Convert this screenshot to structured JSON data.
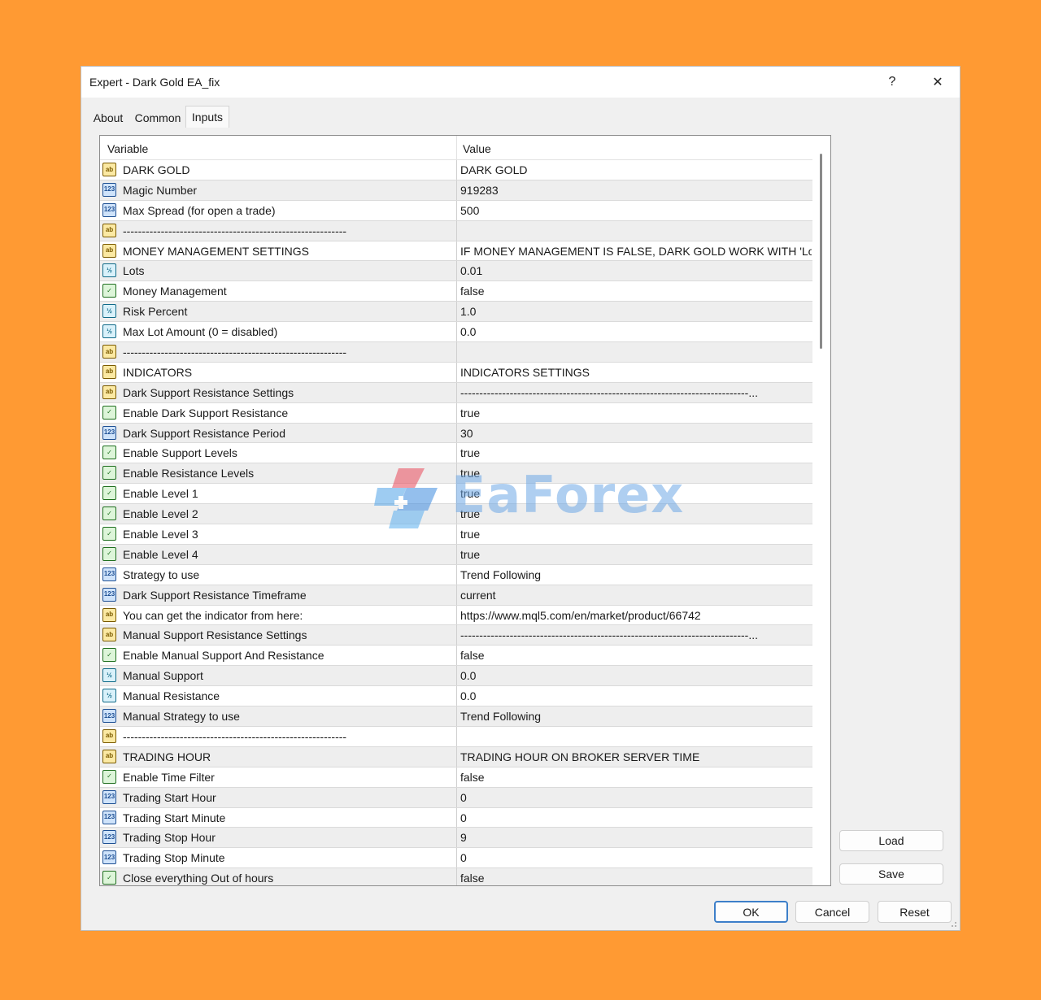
{
  "window": {
    "title": "Expert - Dark Gold EA_fix",
    "help_glyph": "?",
    "close_glyph": "✕"
  },
  "tabs": [
    {
      "label": "About"
    },
    {
      "label": "Common"
    },
    {
      "label": "Inputs"
    }
  ],
  "grid": {
    "headers": {
      "variable": "Variable",
      "value": "Value"
    },
    "rows": [
      {
        "type": "string",
        "variable": "DARK GOLD",
        "value": "DARK GOLD"
      },
      {
        "type": "int",
        "variable": "Magic Number",
        "value": "919283"
      },
      {
        "type": "int",
        "variable": "Max Spread (for open a trade)",
        "value": "500"
      },
      {
        "type": "string",
        "variable": "-----------------------------------------------------------",
        "value": ""
      },
      {
        "type": "string",
        "variable": "MONEY MANAGEMENT SETTINGS",
        "value": "IF MONEY MANAGEMENT IS FALSE, DARK GOLD WORK WITH 'Lots'"
      },
      {
        "type": "double",
        "variable": "Lots",
        "value": "0.01"
      },
      {
        "type": "bool",
        "variable": "Money Management",
        "value": "false"
      },
      {
        "type": "double",
        "variable": "Risk Percent",
        "value": "1.0"
      },
      {
        "type": "double",
        "variable": "Max Lot Amount (0 = disabled)",
        "value": "0.0"
      },
      {
        "type": "string",
        "variable": "-----------------------------------------------------------",
        "value": ""
      },
      {
        "type": "string",
        "variable": "INDICATORS",
        "value": "INDICATORS SETTINGS"
      },
      {
        "type": "string",
        "variable": "Dark Support Resistance Settings",
        "value": "----------------------------------------------------------------------------..."
      },
      {
        "type": "bool",
        "variable": "Enable Dark Support Resistance",
        "value": "true"
      },
      {
        "type": "int",
        "variable": "Dark Support Resistance Period",
        "value": "30"
      },
      {
        "type": "bool",
        "variable": "Enable Support Levels",
        "value": "true"
      },
      {
        "type": "bool",
        "variable": "Enable Resistance Levels",
        "value": "true"
      },
      {
        "type": "bool",
        "variable": "Enable Level 1",
        "value": "true"
      },
      {
        "type": "bool",
        "variable": "Enable Level 2",
        "value": "true"
      },
      {
        "type": "bool",
        "variable": "Enable Level 3",
        "value": "true"
      },
      {
        "type": "bool",
        "variable": "Enable Level 4",
        "value": "true"
      },
      {
        "type": "int",
        "variable": "Strategy to use",
        "value": "Trend Following"
      },
      {
        "type": "int",
        "variable": "Dark Support Resistance Timeframe",
        "value": "current"
      },
      {
        "type": "string",
        "variable": "You can get the indicator from here:",
        "value": "https://www.mql5.com/en/market/product/66742"
      },
      {
        "type": "string",
        "variable": "Manual Support Resistance Settings",
        "value": "----------------------------------------------------------------------------..."
      },
      {
        "type": "bool",
        "variable": "Enable Manual Support And Resistance",
        "value": "false"
      },
      {
        "type": "double",
        "variable": "Manual Support",
        "value": "0.0"
      },
      {
        "type": "double",
        "variable": "Manual Resistance",
        "value": "0.0"
      },
      {
        "type": "int",
        "variable": "Manual Strategy to use",
        "value": "Trend Following"
      },
      {
        "type": "string",
        "variable": "-----------------------------------------------------------",
        "value": ""
      },
      {
        "type": "string",
        "variable": "TRADING HOUR",
        "value": "TRADING HOUR ON BROKER SERVER TIME"
      },
      {
        "type": "bool",
        "variable": "Enable Time Filter",
        "value": "false"
      },
      {
        "type": "int",
        "variable": "Trading Start Hour",
        "value": "0"
      },
      {
        "type": "int",
        "variable": "Trading Start Minute",
        "value": "0"
      },
      {
        "type": "int",
        "variable": "Trading Stop Hour",
        "value": "9"
      },
      {
        "type": "int",
        "variable": "Trading Stop Minute",
        "value": "0"
      },
      {
        "type": "bool",
        "variable": "Close everything Out of hours",
        "value": "false"
      }
    ]
  },
  "icons": {
    "string": {
      "name": "string-type-icon",
      "glyph": "ab"
    },
    "int": {
      "name": "integer-type-icon",
      "glyph": "123"
    },
    "double": {
      "name": "double-type-icon",
      "glyph": "½"
    },
    "bool": {
      "name": "bool-type-icon",
      "glyph": "✓"
    }
  },
  "buttons": {
    "load": "Load",
    "save": "Save",
    "ok": "OK",
    "cancel": "Cancel",
    "reset": "Reset"
  },
  "watermark": {
    "text": "EaForex"
  },
  "colors": {
    "page_background": "#FF9A33",
    "primary_border": "#3D7FC9"
  }
}
